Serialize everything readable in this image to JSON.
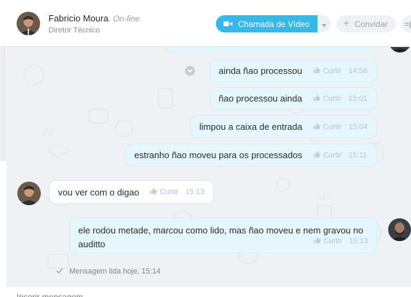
{
  "header": {
    "contact_name": "Fabricio Moura",
    "contact_status": ". On-line",
    "contact_role": "Diretor Técnico",
    "video_call_label": "Chamada de Vídeo",
    "invite_label": "Convidar",
    "more_label": "=(",
    "icons": {
      "video": "video-camera-icon",
      "caret": "chevron-down-icon",
      "invite": "plus-icon"
    }
  },
  "colors": {
    "accent": "#36b8e8",
    "outgoing_bubble": "#e6f6fe",
    "incoming_bubble": "#ffffff",
    "chat_background": "#eef2f4",
    "meta_text": "#b6c2ca"
  },
  "messages": [
    {
      "direction": "out",
      "text": "ainda ñao processou",
      "like_label": "Curtir",
      "time": "14:56"
    },
    {
      "direction": "out",
      "text": "ñao processou ainda",
      "like_label": "Curtir",
      "time": "15:01"
    },
    {
      "direction": "out",
      "text": "limpou a caixa de entrada",
      "like_label": "Curtir",
      "time": "15:04"
    },
    {
      "direction": "out",
      "text": "estranho ñao moveu para os processados",
      "like_label": "Curtir",
      "time": "15:11"
    },
    {
      "direction": "in",
      "text": "vou ver com o digao",
      "like_label": "Curtir",
      "time": "15:13"
    },
    {
      "direction": "out",
      "text": "ele rodou metade, marcou como lido, mas ñao moveu e nem gravou no auditto",
      "like_label": "Curtir",
      "time": "15:13"
    }
  ],
  "read_receipt": "Mensagem lida hoje, 15:14",
  "composer": {
    "placeholder": "Inserir mensagem"
  }
}
